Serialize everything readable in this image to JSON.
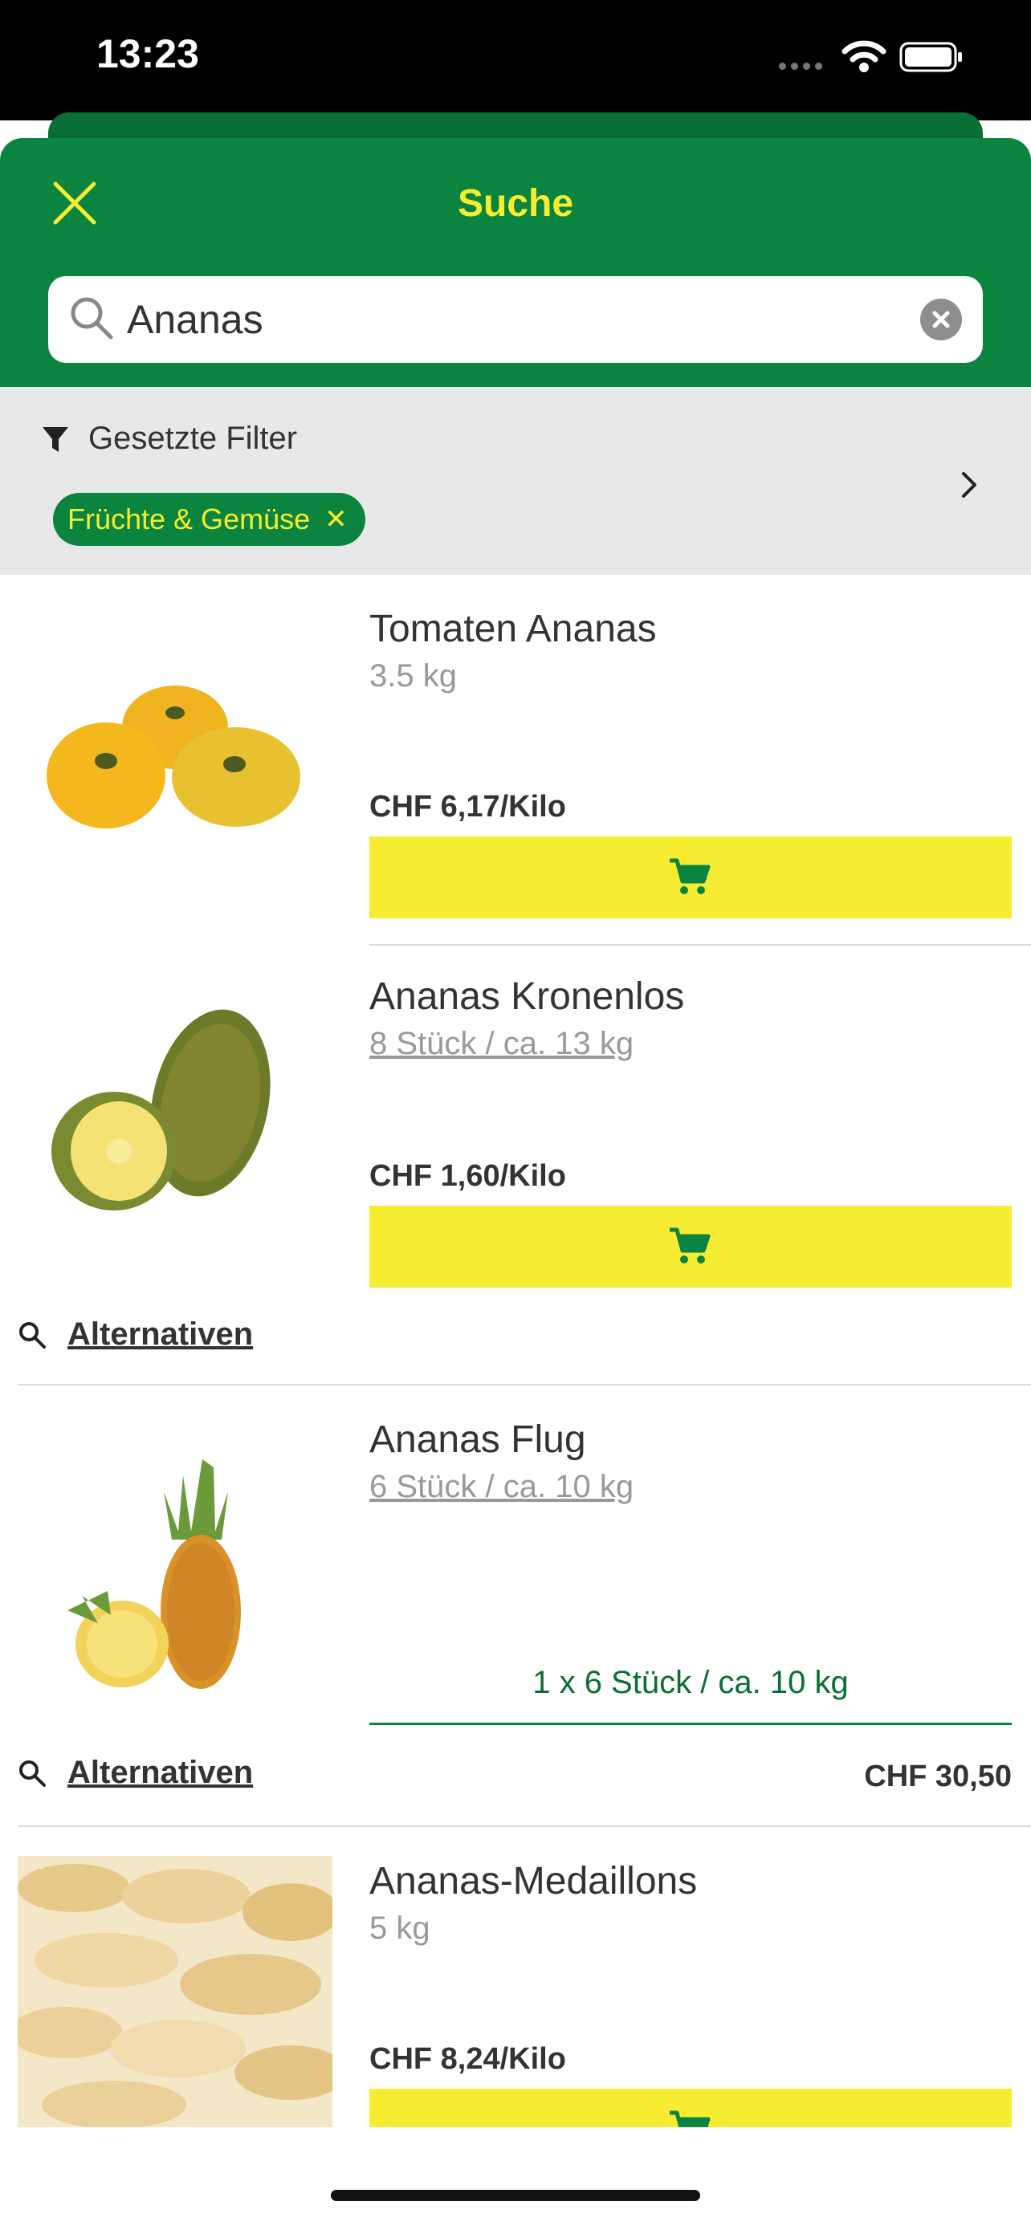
{
  "status_bar": {
    "time": "13:23"
  },
  "header": {
    "title": "Suche",
    "close_icon": "close-icon"
  },
  "search": {
    "value": "Ananas",
    "placeholder": ""
  },
  "filter": {
    "title": "Gesetzte Filter",
    "chips": [
      {
        "label": "Früchte & Gemüse"
      }
    ]
  },
  "products": [
    {
      "name": "Tomaten Ananas",
      "unit": "3.5 kg",
      "price": "CHF 6,17/Kilo"
    },
    {
      "name": "Ananas Kronenlos",
      "unit": "8 Stück / ca. 13 kg",
      "price": "CHF 1,60/Kilo",
      "alternatives": "Alternativen"
    },
    {
      "name": "Ananas Flug",
      "unit": "6 Stück / ca. 10 kg",
      "quantity": "1 x 6 Stück / ca. 10 kg",
      "alternatives": "Alternativen",
      "total": "CHF 30,50"
    },
    {
      "name": "Ananas-Medaillons",
      "unit": "5 kg",
      "price": "CHF 8,24/Kilo"
    }
  ],
  "colors": {
    "brand_green": "#0b843f",
    "accent_yellow": "#f6ed33"
  }
}
